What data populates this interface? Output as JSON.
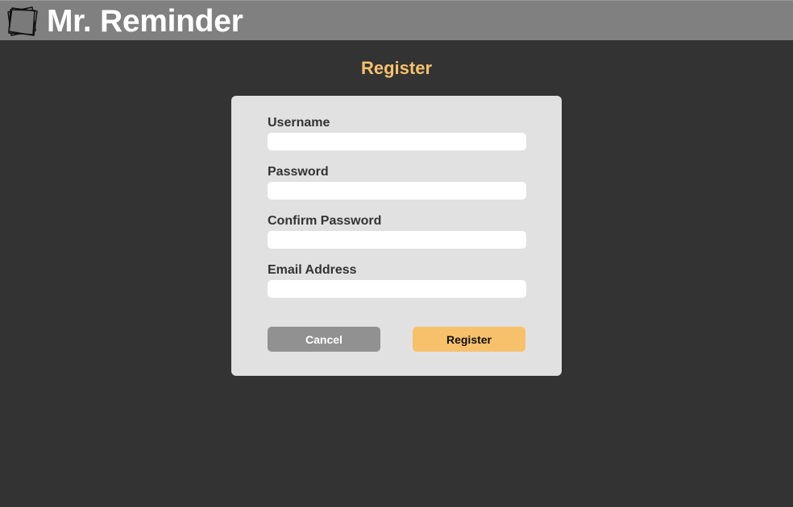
{
  "header": {
    "app_title": "Mr. Reminder",
    "logo_icon": "sticky-notes-icon",
    "background_color": "#808080"
  },
  "page": {
    "title": "Register",
    "title_color": "#f7c16c",
    "background_color": "#333333"
  },
  "form": {
    "fields": [
      {
        "label": "Username",
        "value": "",
        "placeholder": ""
      },
      {
        "label": "Password",
        "value": "",
        "placeholder": ""
      },
      {
        "label": "Confirm Password",
        "value": "",
        "placeholder": ""
      },
      {
        "label": "Email Address",
        "value": "",
        "placeholder": ""
      }
    ],
    "cancel_label": "Cancel",
    "register_label": "Register",
    "cancel_color": "#919191",
    "register_color": "#f7c16c",
    "card_color": "#e1e1e1"
  }
}
